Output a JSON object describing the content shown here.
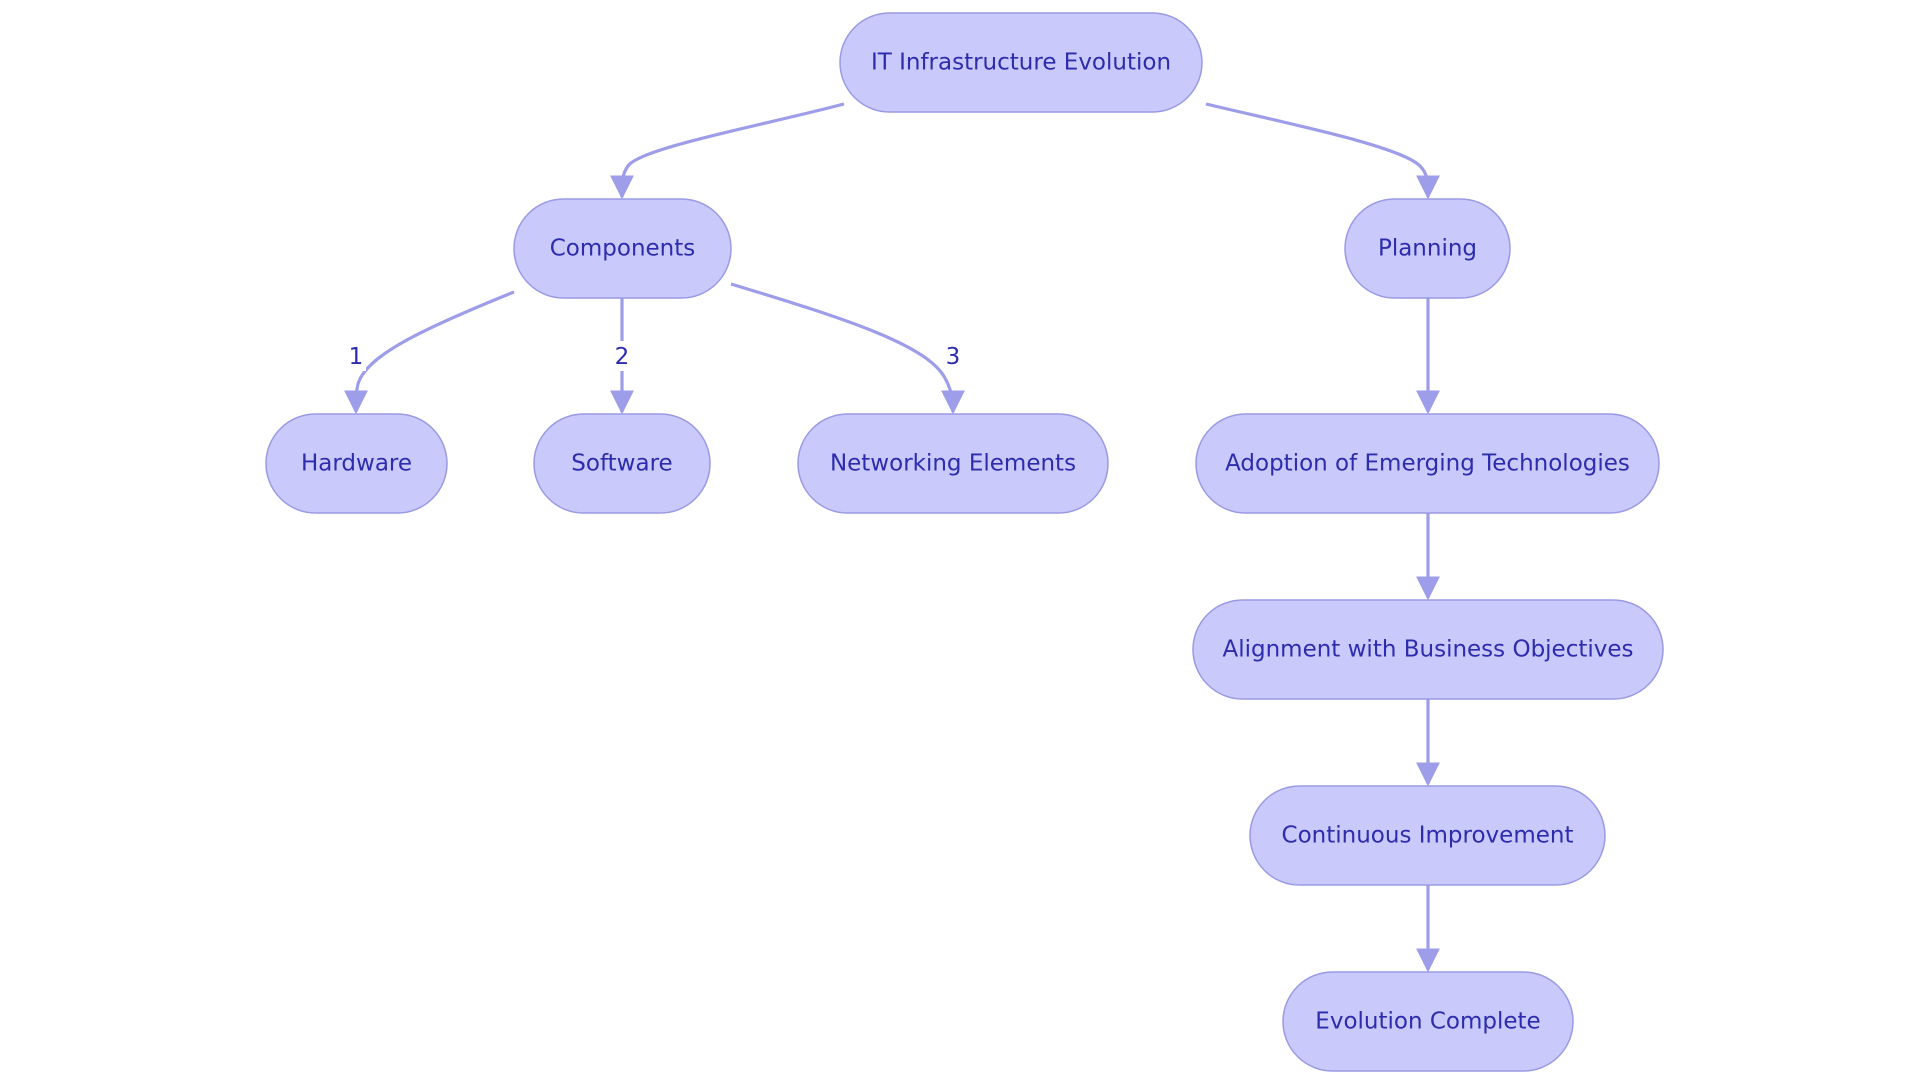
{
  "diagram": {
    "type": "flowchart",
    "colors": {
      "node_fill": "#c9c9fc",
      "node_stroke": "#9a9ae4",
      "text": "#2c2cad",
      "edge": "#9d9de9",
      "background": "#ffffff"
    },
    "nodes": [
      {
        "id": "root",
        "label": "IT Infrastructure Evolution"
      },
      {
        "id": "components",
        "label": "Components"
      },
      {
        "id": "planning",
        "label": "Planning"
      },
      {
        "id": "hardware",
        "label": "Hardware"
      },
      {
        "id": "software",
        "label": "Software"
      },
      {
        "id": "networking",
        "label": "Networking Elements"
      },
      {
        "id": "adoption",
        "label": "Adoption of Emerging Technologies"
      },
      {
        "id": "alignment",
        "label": "Alignment with Business Objectives"
      },
      {
        "id": "improvement",
        "label": "Continuous Improvement"
      },
      {
        "id": "complete",
        "label": "Evolution Complete"
      }
    ],
    "edges": [
      {
        "from": "root",
        "to": "components",
        "label": ""
      },
      {
        "from": "root",
        "to": "planning",
        "label": ""
      },
      {
        "from": "components",
        "to": "hardware",
        "label": "1"
      },
      {
        "from": "components",
        "to": "software",
        "label": "2"
      },
      {
        "from": "components",
        "to": "networking",
        "label": "3"
      },
      {
        "from": "planning",
        "to": "adoption",
        "label": ""
      },
      {
        "from": "adoption",
        "to": "alignment",
        "label": ""
      },
      {
        "from": "alignment",
        "to": "improvement",
        "label": ""
      },
      {
        "from": "improvement",
        "to": "complete",
        "label": ""
      }
    ]
  }
}
